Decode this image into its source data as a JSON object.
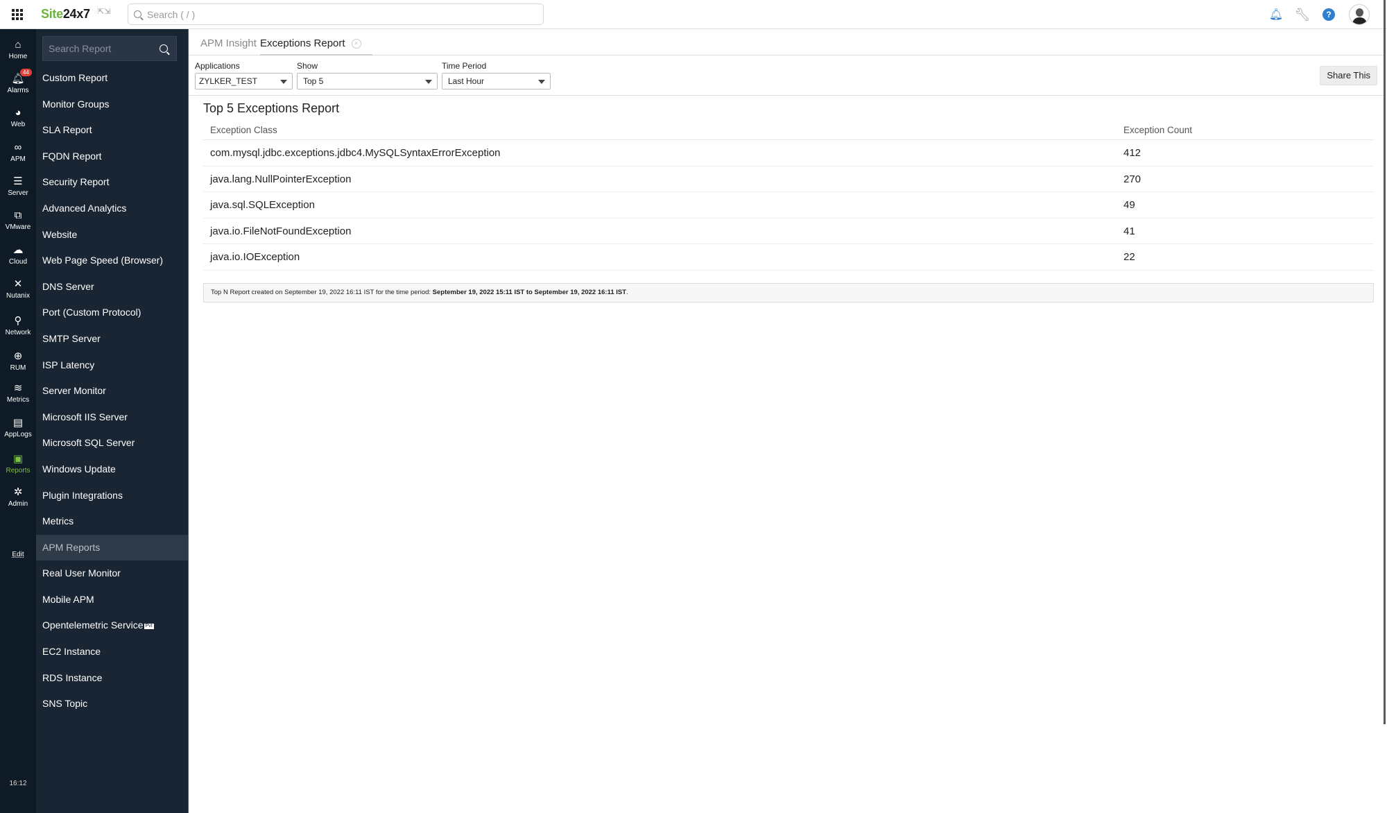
{
  "topbar": {
    "logo_green": "Site",
    "logo_dark": "24x7",
    "search_placeholder": "Search ( / )",
    "icons": [
      "apps-grid-icon",
      "expand-icon",
      "bell-icon",
      "wrench-icon",
      "help-icon",
      "avatar"
    ]
  },
  "rail": {
    "items": [
      {
        "label": "Home",
        "icon": "home-icon"
      },
      {
        "label": "Alarms",
        "icon": "bell-icon",
        "badge": "44"
      },
      {
        "label": "Web",
        "icon": "globe-icon"
      },
      {
        "label": "APM",
        "icon": "binoculars-icon"
      },
      {
        "label": "Server",
        "icon": "server-icon"
      },
      {
        "label": "VMware",
        "icon": "vmware-icon"
      },
      {
        "label": "Cloud",
        "icon": "cloud-icon"
      },
      {
        "label": "Nutanix",
        "icon": "nutanix-icon"
      },
      {
        "label": "Network",
        "icon": "network-icon"
      },
      {
        "label": "RUM",
        "icon": "rum-icon"
      },
      {
        "label": "Metrics",
        "icon": "layers-icon"
      },
      {
        "label": "AppLogs",
        "icon": "applogs-icon"
      },
      {
        "label": "Reports",
        "icon": "reports-icon",
        "active": true
      },
      {
        "label": "Admin",
        "icon": "gear-icon"
      }
    ],
    "edit_label": "Edit",
    "time": "16:12",
    "active_color": "#7cc242"
  },
  "menu": {
    "search_placeholder": "Search Report",
    "items": [
      "Custom Report",
      "Monitor Groups",
      "SLA Report",
      "FQDN Report",
      "Security Report",
      "Advanced Analytics",
      "Website",
      "Web Page Speed (Browser)",
      "DNS Server",
      "Port (Custom Protocol)",
      "SMTP Server",
      "ISP Latency",
      "Server Monitor",
      "Microsoft IIS Server",
      "Microsoft SQL Server",
      "Windows Update",
      "Plugin Integrations",
      "Metrics",
      "APM Reports",
      "Real User Monitor",
      "Mobile APM",
      "Opentelemetric Service",
      "EC2 Instance",
      "RDS Instance",
      "SNS Topic"
    ],
    "active_item": "APM Reports",
    "pvt_badge": "Pvt"
  },
  "tabs": {
    "apm_insight": "APM Insight",
    "exceptions_report": "Exceptions Report",
    "close_symbol": "×"
  },
  "filters": {
    "applications_label": "Applications",
    "applications_value": "ZYLKER_TEST",
    "show_label": "Show",
    "show_value": "Top 5",
    "time_period_label": "Time Period",
    "time_period_value": "Last Hour",
    "share_label": "Share This"
  },
  "report": {
    "title": "Top 5 Exceptions Report",
    "columns": [
      "Exception Class",
      "Exception Count"
    ],
    "rows": [
      {
        "class": "com.mysql.jdbc.exceptions.jdbc4.MySQLSyntaxErrorException",
        "count": "412"
      },
      {
        "class": "java.lang.NullPointerException",
        "count": "270"
      },
      {
        "class": "java.sql.SQLException",
        "count": "49"
      },
      {
        "class": "java.io.FileNotFoundException",
        "count": "41"
      },
      {
        "class": "java.io.IOException",
        "count": "22"
      }
    ],
    "footer_prefix": "Top N Report created on September 19, 2022 16:11 IST for the time period: ",
    "footer_from": "September 19, 2022 15:11 IST",
    "footer_to_word": " to ",
    "footer_to": "September 19, 2022 16:11 IST",
    "footer_suffix": "."
  }
}
